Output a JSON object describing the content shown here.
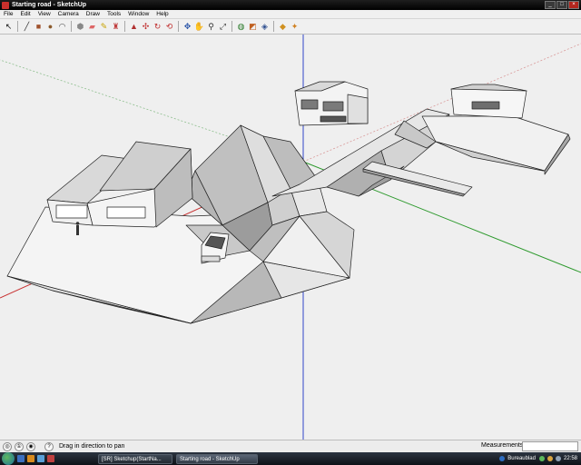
{
  "window": {
    "title": "Starting road - SketchUp"
  },
  "menu": [
    "File",
    "Edit",
    "View",
    "Camera",
    "Draw",
    "Tools",
    "Window",
    "Help"
  ],
  "toolbar": {
    "groups": [
      [
        {
          "name": "select-tool-icon",
          "glyph": "↖",
          "color": "#111"
        }
      ],
      [
        {
          "name": "line-tool-icon",
          "glyph": "╱",
          "color": "#333"
        },
        {
          "name": "rectangle-tool-icon",
          "glyph": "■",
          "color": "#a0522d"
        },
        {
          "name": "circle-tool-icon",
          "glyph": "●",
          "color": "#8b5a2b"
        },
        {
          "name": "arc-tool-icon",
          "glyph": "◠",
          "color": "#444"
        }
      ],
      [
        {
          "name": "make-component-icon",
          "glyph": "⬢",
          "color": "#888"
        },
        {
          "name": "eraser-tool-icon",
          "glyph": "▰",
          "color": "#d66"
        },
        {
          "name": "tape-measure-icon",
          "glyph": "✎",
          "color": "#c8a200"
        },
        {
          "name": "paint-bucket-icon",
          "glyph": "♜",
          "color": "#c04040"
        }
      ],
      [
        {
          "name": "push-pull-icon",
          "glyph": "▲",
          "color": "#b03030"
        },
        {
          "name": "move-tool-icon",
          "glyph": "✣",
          "color": "#c03030"
        },
        {
          "name": "rotate-tool-icon",
          "glyph": "↻",
          "color": "#c03030"
        },
        {
          "name": "offset-tool-icon",
          "glyph": "⟲",
          "color": "#c03030"
        }
      ],
      [
        {
          "name": "orbit-tool-icon",
          "glyph": "✥",
          "color": "#2a55a8"
        },
        {
          "name": "pan-tool-icon",
          "glyph": "✋",
          "color": "#555"
        },
        {
          "name": "zoom-tool-icon",
          "glyph": "⚲",
          "color": "#333"
        },
        {
          "name": "zoom-extents-icon",
          "glyph": "⤢",
          "color": "#333"
        }
      ],
      [
        {
          "name": "get-models-icon",
          "glyph": "◍",
          "color": "#2a7a2a"
        },
        {
          "name": "share-model-icon",
          "glyph": "◩",
          "color": "#c06020"
        },
        {
          "name": "component-store-icon",
          "glyph": "◈",
          "color": "#305090"
        }
      ],
      [
        {
          "name": "materials-icon",
          "glyph": "◆",
          "color": "#d09020"
        },
        {
          "name": "styles-icon",
          "glyph": "✦",
          "color": "#d08020"
        }
      ]
    ]
  },
  "status": {
    "hint": "Drag in direction to pan",
    "measurements_label": "Measurements",
    "measurements_value": ""
  },
  "taskbar": {
    "tasks": [
      {
        "label": "[SR] Sketchup(StartNa...",
        "active": false
      },
      {
        "label": "Starting road - SketchUp",
        "active": true
      }
    ],
    "tray_label": "Bureaublad",
    "clock": "22:58"
  },
  "colors": {
    "axis_red": "#c83232",
    "axis_green": "#2e9a2e",
    "axis_blue": "#3246c8",
    "face_light": "#ffffff",
    "face_mid": "#d0d0d0",
    "face_dark": "#9a9a9a"
  }
}
